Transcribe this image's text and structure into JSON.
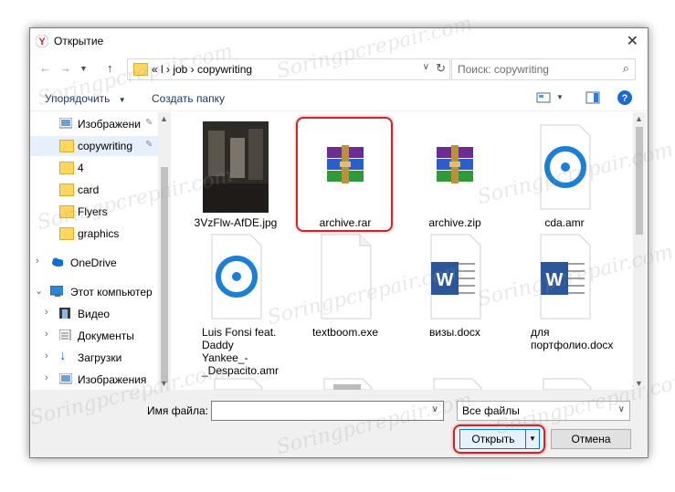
{
  "window": {
    "title": "Открытие",
    "close_icon": "close-icon"
  },
  "nav": {
    "back": "←",
    "forward": "→",
    "up": "↑"
  },
  "address": {
    "crumbs": "«  l  ›  job  ›  copywriting"
  },
  "search": {
    "placeholder": "Поиск: copywriting"
  },
  "toolbar": {
    "organize": "Упорядочить",
    "new_folder": "Создать папку"
  },
  "sidebar": {
    "items": [
      {
        "label": "Изображени"
      },
      {
        "label": "copywriting"
      },
      {
        "label": "4"
      },
      {
        "label": "card"
      },
      {
        "label": "Flyers"
      },
      {
        "label": "graphics"
      },
      {
        "label": "OneDrive"
      },
      {
        "label": "Этот компьютер"
      },
      {
        "label": "Видео"
      },
      {
        "label": "Документы"
      },
      {
        "label": "Загрузки"
      },
      {
        "label": "Изображения"
      }
    ]
  },
  "files": [
    {
      "name": "3VzFlw-AfDE.jpg",
      "icon": "photo-thumbnail"
    },
    {
      "name": "archive.rar",
      "icon": "winrar-archive-icon"
    },
    {
      "name": "archive.zip",
      "icon": "winrar-archive-icon"
    },
    {
      "name": "cda.amr",
      "icon": "audio-file-icon"
    },
    {
      "name": "Luis Fonsi feat. Daddy Yankee_-_Despacito.amr",
      "icon": "audio-file-icon"
    },
    {
      "name": "textboom.exe",
      "icon": "blank-file-icon"
    },
    {
      "name": "визы.docx",
      "icon": "word-document-icon"
    },
    {
      "name": "для портфолио.docx",
      "icon": "word-document-icon"
    }
  ],
  "bottom": {
    "filename_label": "Имя файла:",
    "filename_value": "",
    "filter_value": "Все файлы",
    "open_label": "Открыть",
    "cancel_label": "Отмена"
  },
  "watermark": "Soringpcrepair.com",
  "colors": {
    "highlight": "#d2232a",
    "selection": "#e5f0fb",
    "link": "#1e3a6b"
  }
}
